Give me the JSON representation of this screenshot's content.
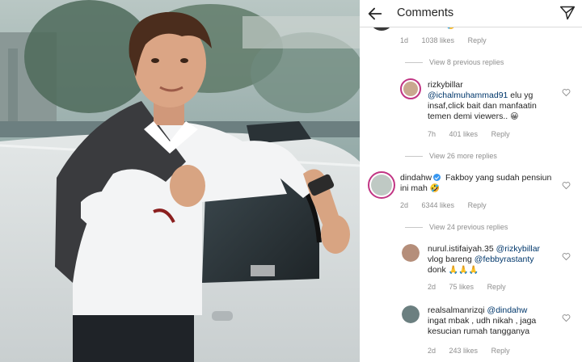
{
  "header": {
    "title": "Comments",
    "back_icon": "arrow-left-icon",
    "send_icon": "paper-plane-icon"
  },
  "partial_comment": {
    "text": "manusia ini 🤣",
    "time": "1d",
    "likes": "1038 likes",
    "reply": "Reply"
  },
  "view_previous_1": "View 8 previous replies",
  "reply_rizky": {
    "username": "rizkybillar",
    "mention": "@ichalmuhammad91",
    "text": " elu yg insaf,click bait dan manfaatin temen demi viewers..",
    "emoji": "😀",
    "time": "7h",
    "likes": "401 likes",
    "reply": "Reply"
  },
  "view_more_1": "View 26 more replies",
  "comment_dinda": {
    "username": "dindahw",
    "text": "Fakboy yang sudah pensiun ini mah",
    "emoji": "🤣",
    "time": "2d",
    "likes": "6344 likes",
    "reply": "Reply"
  },
  "view_previous_2": "View 24 previous replies",
  "reply_nurul": {
    "username": "nurul.istifaiyah.35",
    "mention1": "@rizkybillar",
    "text1": "vlog bareng ",
    "mention2": "@febbyrastanty",
    "text2": "donk ",
    "emoji": "🙏🙏🙏",
    "time": "2d",
    "likes": "75 likes",
    "reply": "Reply"
  },
  "reply_real": {
    "username": "realsalmanrizqi",
    "mention": "@dindahw",
    "text": "ingat mbak , udh nikah , jaga kesucian rumah tangganya",
    "time": "2d",
    "likes": "243 likes",
    "reply": "Reply"
  },
  "colors": {
    "mention": "#00376b",
    "meta": "#8e8e8e",
    "verified": "#3897f0"
  }
}
